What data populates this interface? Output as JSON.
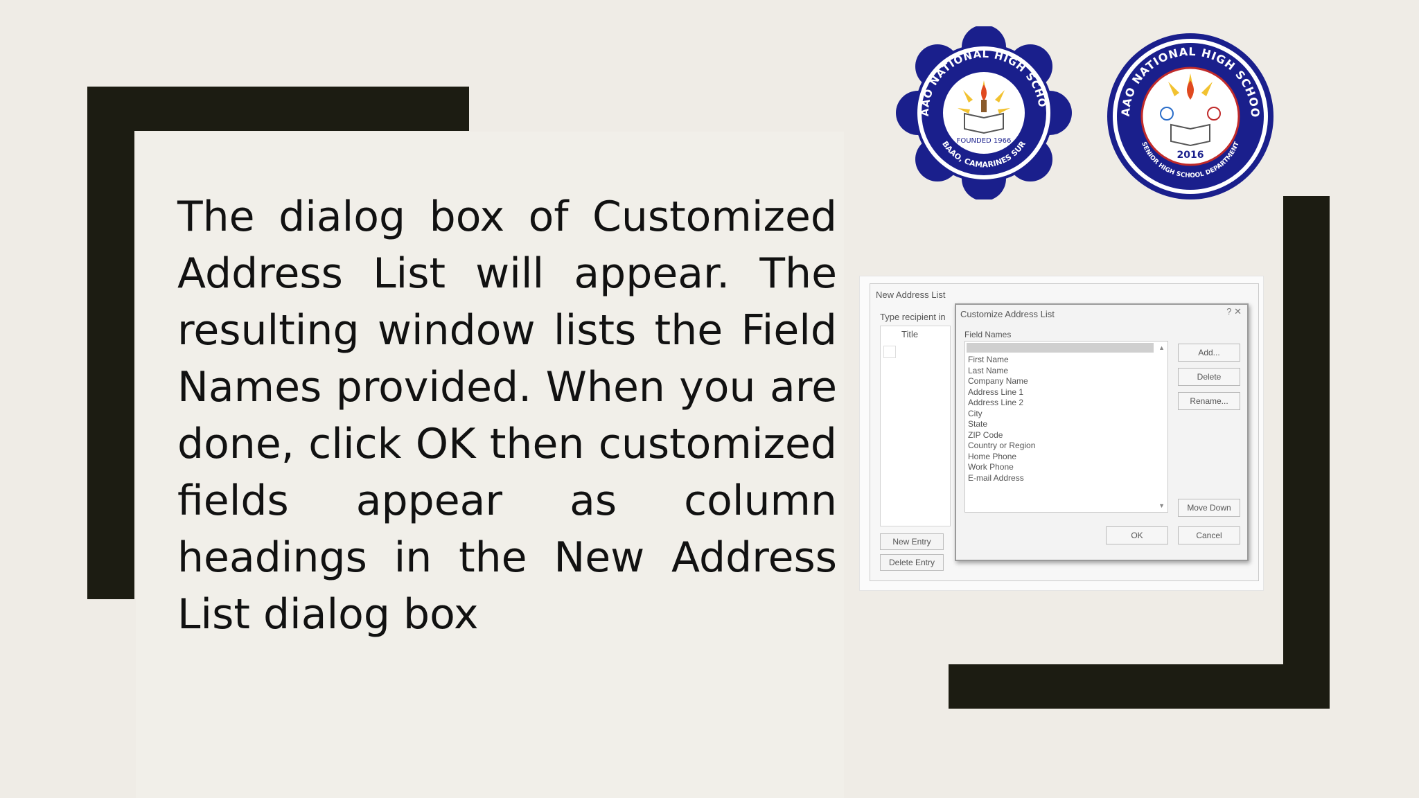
{
  "slide": {
    "body_text": "The dialog box of Customized Address List will appear. The resulting window lists the Field Names provided. When you are done, click OK then customized fields appear as column headings in the New Address List dialog box"
  },
  "logos": [
    {
      "name": "baao-national-high-school-seal",
      "top_arc": "BAAO NATIONAL HIGH SCHOOL",
      "center": "FOUNDED 1966",
      "bottom_arc": "BAAO, CAMARINES SUR"
    },
    {
      "name": "baao-nhs-senior-high-seal",
      "top_arc": "BAAO NATIONAL HIGH SCHOOL",
      "year": "2016",
      "bottom_arc": "SENIOR HIGH SCHOOL DEPARTMENT"
    }
  ],
  "screenshot": {
    "window_title": "New Address List",
    "type_prompt": "Type recipient in",
    "grid_column": "Title",
    "new_entry": "New Entry",
    "delete_entry": "Delete Entry",
    "dialog": {
      "title": "Customize Address List",
      "controls": "?  ✕",
      "field_names_label": "Field Names",
      "fields": [
        "First Name",
        "Last Name",
        "Company Name",
        "Address Line 1",
        "Address Line 2",
        "City",
        "State",
        "ZIP Code",
        "Country or Region",
        "Home Phone",
        "Work Phone",
        "E-mail Address"
      ],
      "buttons": {
        "add": "Add...",
        "delete": "Delete",
        "rename": "Rename...",
        "move_down": "Move Down",
        "ok": "OK",
        "cancel": "Cancel"
      }
    }
  },
  "colors": {
    "background": "#efece6",
    "frame": "#1c1c12",
    "seal_blue": "#1a1f8c",
    "seal_gold": "#f2c230"
  }
}
